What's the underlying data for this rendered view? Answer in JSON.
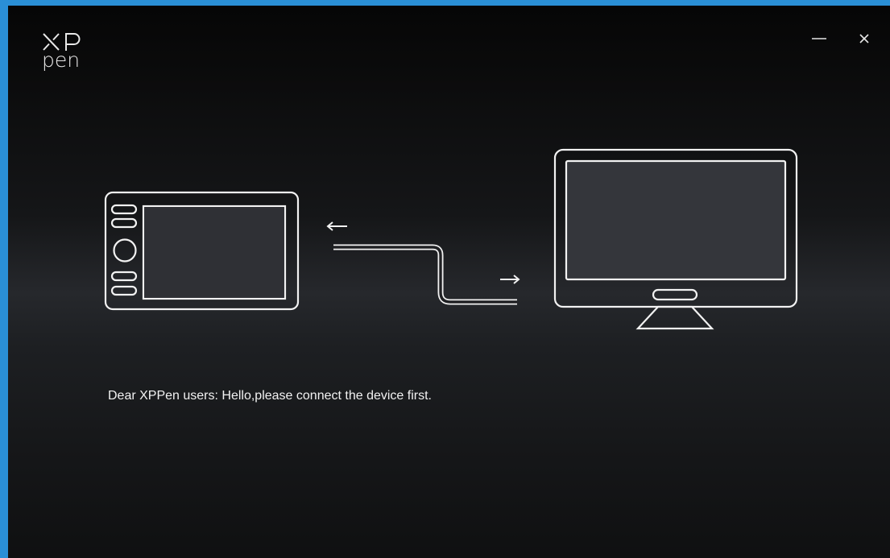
{
  "app": {
    "logo_top": "XP",
    "logo_bottom": "pen"
  },
  "window_controls": {
    "minimize_icon": "minimize-icon",
    "close_icon": "close-icon"
  },
  "illustration": {
    "left_arrow": "←",
    "right_arrow": "→"
  },
  "main": {
    "message": "Dear XPPen users: Hello,please connect the device first."
  }
}
